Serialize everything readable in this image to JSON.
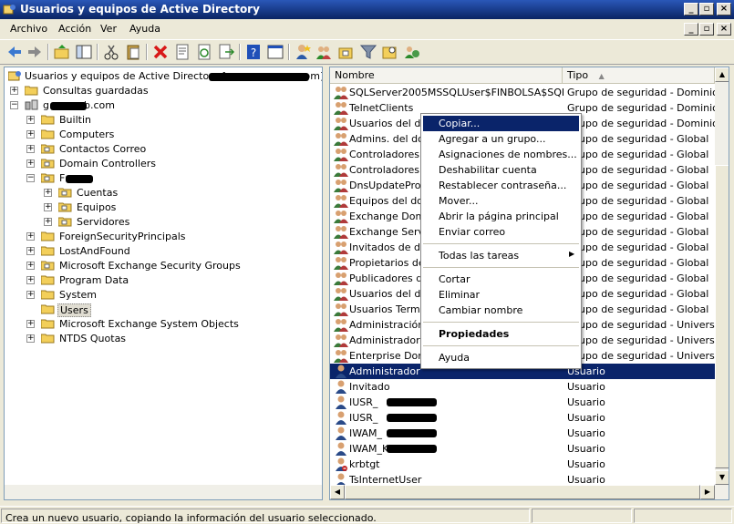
{
  "window": {
    "title": "Usuarios y equipos de Active Directory"
  },
  "menu": [
    "Archivo",
    "Acción",
    "Ver",
    "Ayuda"
  ],
  "toolbar_icons": [
    "back-icon",
    "forward-icon",
    "up-folder-icon",
    "show-hide-tree-icon",
    "cut-icon",
    "paste-icon",
    "delete-icon",
    "properties-icon",
    "refresh-icon",
    "export-icon",
    "help-icon",
    "console-icon",
    "new-user-icon",
    "new-group-icon",
    "new-ou-icon",
    "filter-icon",
    "find-icon",
    "add-to-group-icon"
  ],
  "tree": {
    "root": "Usuarios y equipos de Active Directory [s",
    "root_suffix": "p.com]",
    "saved_queries": "Consultas guardadas",
    "domain_prefix": "g",
    "domain_suffix": "b.com",
    "items": [
      {
        "label": "Builtin"
      },
      {
        "label": "Computers"
      },
      {
        "label": "Contactos Correo"
      },
      {
        "label": "Domain Controllers"
      },
      {
        "label": "F"
      }
    ],
    "sub_items": [
      "Cuentas",
      "Equipos",
      "Servidores"
    ],
    "items_after": [
      "ForeignSecurityPrincipals",
      "LostAndFound",
      "Microsoft Exchange Security Groups",
      "Program Data",
      "System",
      "Users",
      "Microsoft Exchange System Objects",
      "NTDS Quotas"
    ]
  },
  "list": {
    "col_name": "Nombre",
    "col_type": "Tipo",
    "rows": [
      {
        "name": "SQLServer2005MSSQLUser$FINBOLSA$SQLE...",
        "type": "Grupo de seguridad - Dominio loca",
        "kind": "group"
      },
      {
        "name": "TelnetClients",
        "type": "Grupo de seguridad - Dominio loca",
        "kind": "group"
      },
      {
        "name": "Usuarios del dep",
        "type": "Grupo de seguridad - Dominio loca",
        "kind": "group"
      },
      {
        "name": "Admins. del dom",
        "type": "Grupo de seguridad - Global",
        "kind": "group"
      },
      {
        "name": "Controladores de",
        "type": "Grupo de seguridad - Global",
        "kind": "group"
      },
      {
        "name": "Controladores de",
        "type": "Grupo de seguridad - Global",
        "kind": "group"
      },
      {
        "name": "DnsUpdateProxy",
        "type": "Grupo de seguridad - Global",
        "kind": "group"
      },
      {
        "name": "Equipos del domi",
        "type": "Grupo de seguridad - Global",
        "kind": "group"
      },
      {
        "name": "Exchange Domai",
        "type": "Grupo de seguridad - Global",
        "kind": "group"
      },
      {
        "name": "Exchange Servic",
        "type": "Grupo de seguridad - Global",
        "kind": "group"
      },
      {
        "name": "Invitados de dor",
        "type": "Grupo de seguridad - Global",
        "kind": "group"
      },
      {
        "name": "Propietarios del",
        "type": "Grupo de seguridad - Global",
        "kind": "group"
      },
      {
        "name": "Publicadores de",
        "type": "Grupo de seguridad - Global",
        "kind": "group"
      },
      {
        "name": "Usuarios del dor",
        "type": "Grupo de seguridad - Global",
        "kind": "group"
      },
      {
        "name": "Usuarios Termina",
        "type": "Grupo de seguridad - Global",
        "kind": "group"
      },
      {
        "name": "Administración de",
        "type": "Grupo de seguridad - Universal",
        "kind": "group"
      },
      {
        "name": "Administradores",
        "type": "Grupo de seguridad - Universal",
        "kind": "group"
      },
      {
        "name": "Enterprise Doma",
        "type": "Grupo de seguridad - Universal",
        "kind": "group"
      },
      {
        "name": "Administrador",
        "type": "Usuario",
        "kind": "user",
        "selected": true
      },
      {
        "name": "Invitado",
        "type": "Usuario",
        "kind": "user"
      },
      {
        "name": "IUSR_",
        "type": "Usuario",
        "kind": "user",
        "redacted": true
      },
      {
        "name": "IUSR_",
        "type": "Usuario",
        "kind": "user",
        "redacted": true
      },
      {
        "name": "IWAM_",
        "type": "Usuario",
        "kind": "user",
        "redacted": true
      },
      {
        "name": "IWAM_K",
        "type": "Usuario",
        "kind": "user",
        "redacted": true
      },
      {
        "name": "krbtgt",
        "type": "Usuario",
        "kind": "user-disabled"
      },
      {
        "name": "TsInternetUser",
        "type": "Usuario",
        "kind": "user"
      }
    ]
  },
  "context_menu": {
    "group1": [
      "Copiar...",
      "Agregar a un grupo...",
      "Asignaciones de nombres...",
      "Deshabilitar cuenta",
      "Restablecer contraseña...",
      "Mover...",
      "Abrir la página principal",
      "Enviar correo"
    ],
    "all_tasks": "Todas las tareas",
    "group2": [
      "Cortar",
      "Eliminar",
      "Cambiar nombre"
    ],
    "properties": "Propiedades",
    "help": "Ayuda"
  },
  "status": {
    "text": "Crea un nuevo usuario, copiando la información del usuario seleccionado."
  },
  "colors": {
    "selection": "#0a246a",
    "window_bg": "#ece9d8",
    "titlebar": "#0a2463"
  }
}
